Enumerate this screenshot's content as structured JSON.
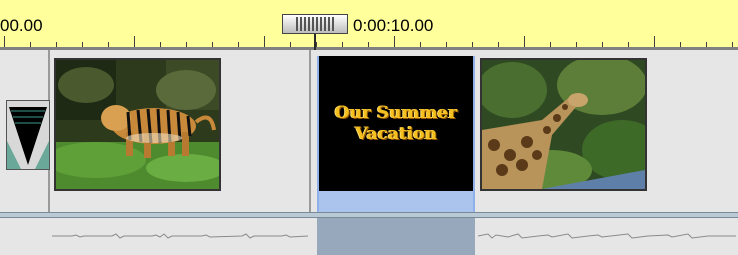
{
  "ruler": {
    "start_label": "00.00",
    "current_time_label": "0:00:10.00"
  },
  "video_track": {
    "clips": [
      {
        "name": "tiger-clip",
        "content": "tiger walking on grass"
      },
      {
        "name": "title-clip",
        "lines": [
          "Our Summer",
          "Vacation"
        ],
        "selected": true
      },
      {
        "name": "giraffe-clip",
        "content": "giraffe among trees"
      }
    ],
    "transition_marker_icon": "transition-triangle-icon"
  },
  "audio_track": {
    "waveform_icon": "audio-waveform-icon"
  },
  "colors": {
    "ruler_bg": "#ffff9c",
    "selection": "#aac4ee",
    "title_text": "#f4c020",
    "track_bg": "#e6e6e6"
  }
}
